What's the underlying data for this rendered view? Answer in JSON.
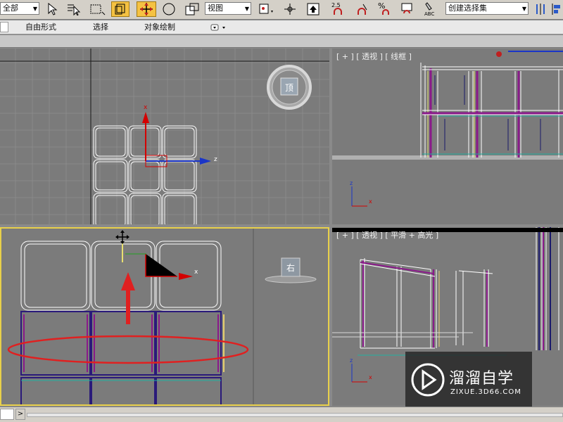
{
  "toolbar": {
    "layer_value": "全部",
    "view_value": "视图",
    "selection_set_value": "创建选择集",
    "angle_snap_label": "2.5",
    "percent_snap_label": "%",
    "abc_label": "ABC"
  },
  "ribbon": {
    "tabs": [
      "自由形式",
      "选择",
      "对象绘制"
    ]
  },
  "viewports": {
    "top": {
      "gizmo_label": "顶",
      "axis_x": "x",
      "axis_z": "z"
    },
    "perspective": {
      "label": "[ + ] [ 透视 ] [ 线框 ]",
      "axis_x": "x",
      "axis_z": "z"
    },
    "right": {
      "gizmo_label": "右",
      "axis_x": "x"
    },
    "camera": {
      "label": "[ + ] [ 透视 ] [ 平滑 + 高光 ]",
      "axis_x": "x",
      "axis_z": "z"
    }
  },
  "statusbar": {
    "expand_label": ">"
  },
  "watermark": {
    "brand": "溜溜自学",
    "url": "ZIXUE.3D66.COM"
  },
  "colors": {
    "active_border": "#e8d04a",
    "viewport_bg": "#7b7b7b",
    "wire": "#ffffff",
    "gizmo_red": "#d40000",
    "gizmo_blue": "#1a35c8",
    "annotation_red": "#e02020"
  }
}
